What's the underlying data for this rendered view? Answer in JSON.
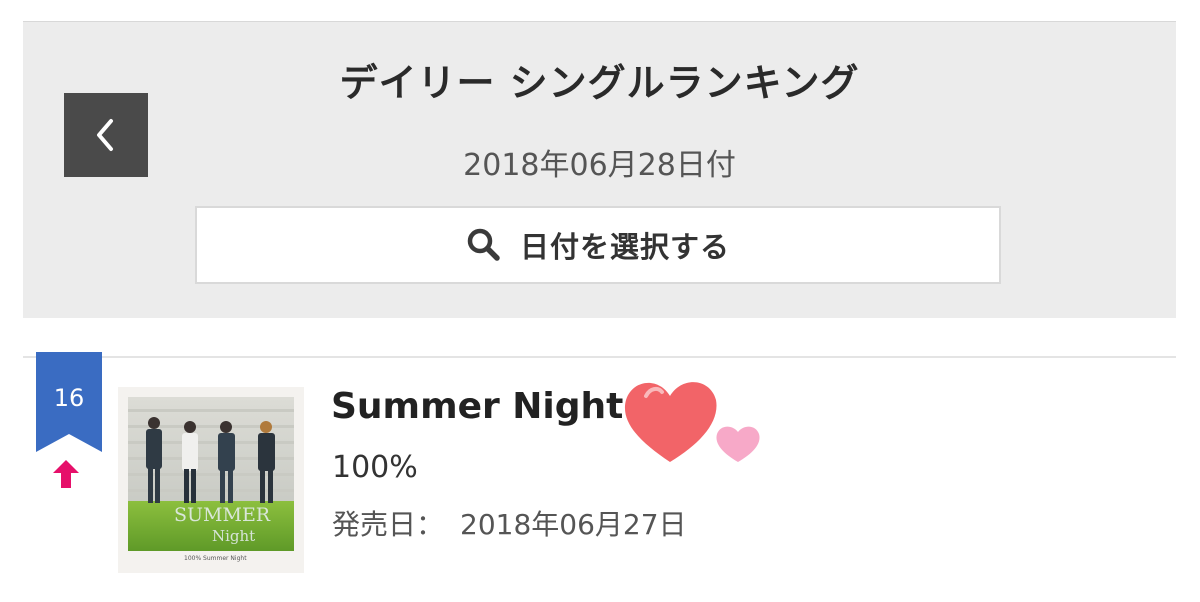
{
  "header": {
    "title": "デイリー シングルランキング",
    "date": "2018年06月28日付",
    "back_icon": "chevron-left-icon",
    "date_select": {
      "label": "日付を選択する",
      "icon": "search-icon"
    }
  },
  "ranking": {
    "entries": [
      {
        "rank": "16",
        "trend": "up-arrow-icon",
        "title": "Summer Night",
        "artist": "100%",
        "release_label": "発売日：",
        "release_date": "2018年06月27日",
        "cover": {
          "text_line1": "SUMMER",
          "text_line2": "Night",
          "caption": "100% Summer Night"
        }
      }
    ]
  },
  "colors": {
    "ribbon": "#3a6cc2",
    "trend_up": "#e6106a",
    "header_bg": "#ececec",
    "back_button_bg": "#4a4a4a",
    "heart_large": "#f26468",
    "heart_small": "#f7a9c8"
  },
  "decorations": {
    "sticker": "hearts-sticker"
  }
}
